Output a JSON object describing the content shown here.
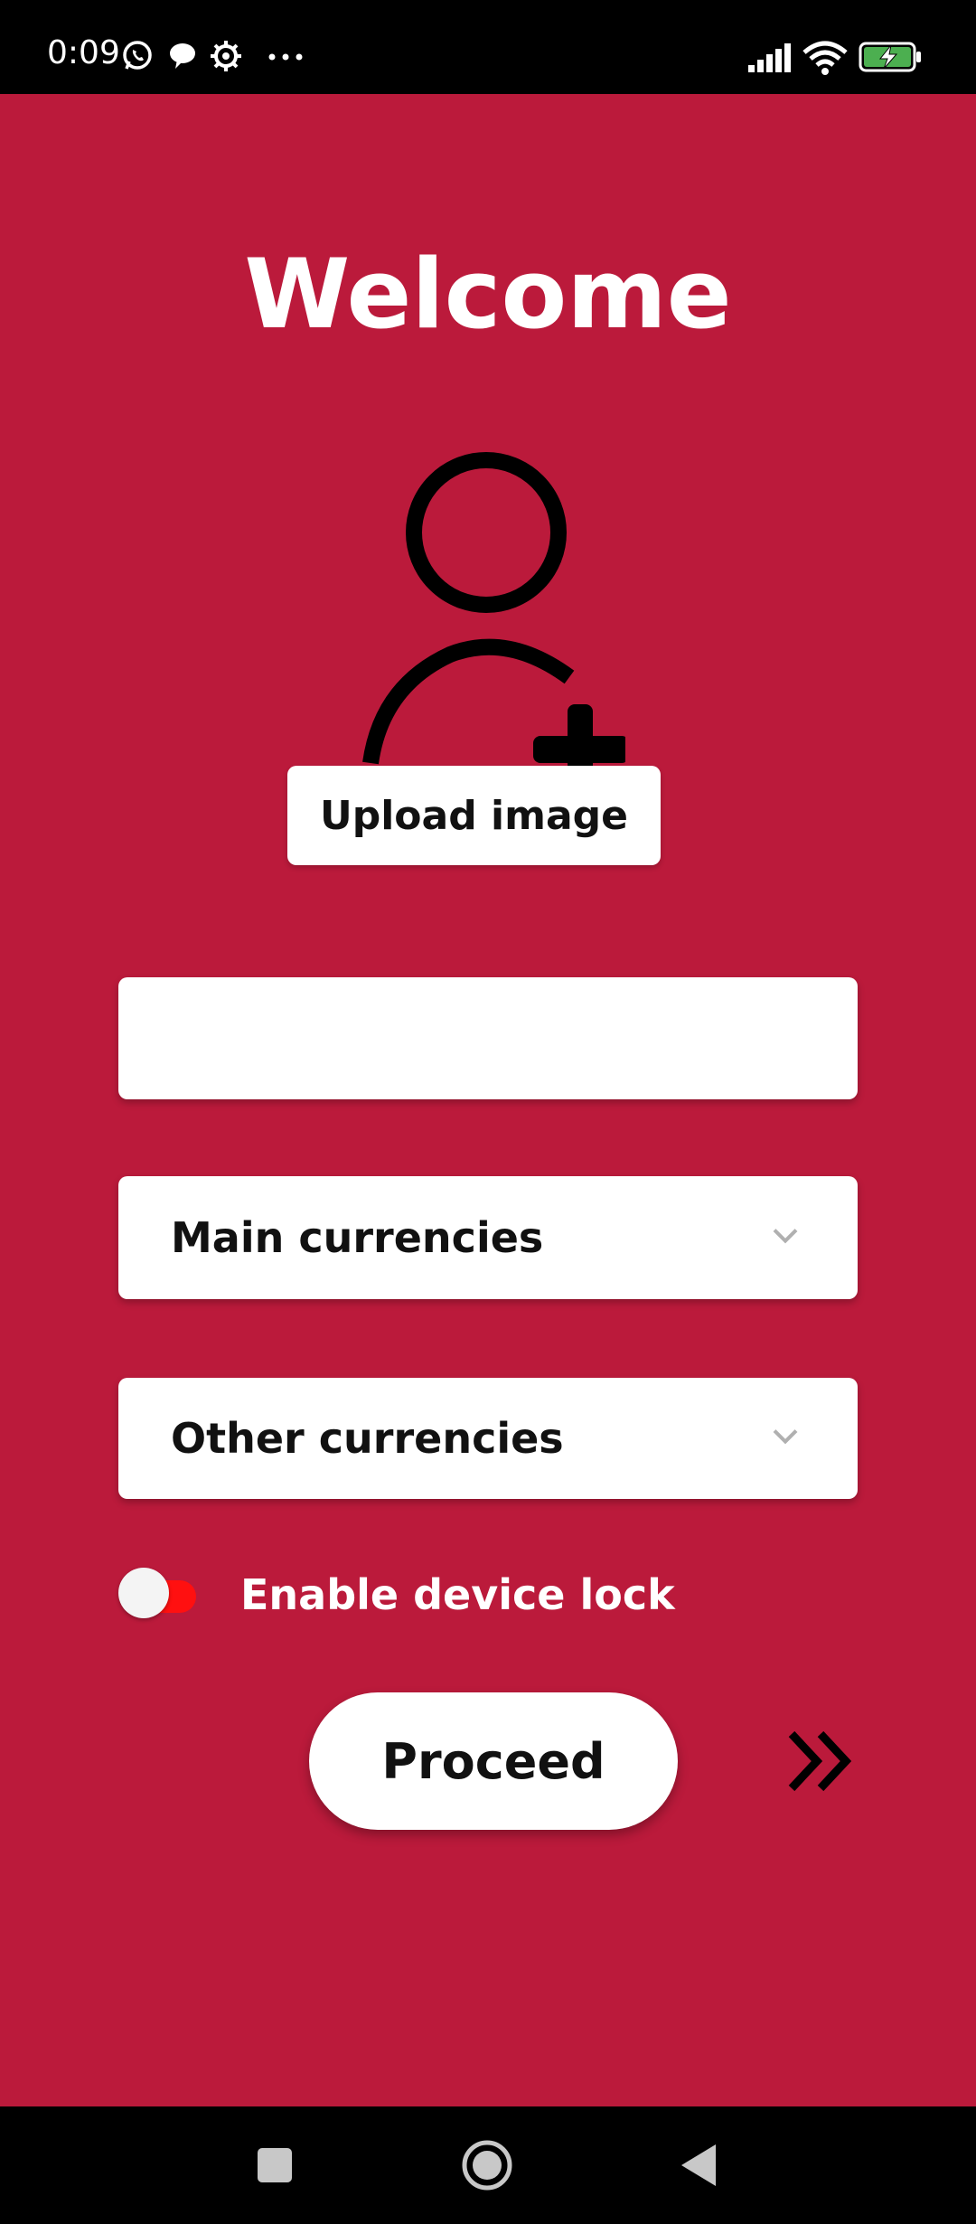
{
  "status_bar": {
    "time": "0:09",
    "icons": [
      "whatsapp-icon",
      "chat-bubble-icon",
      "settings-gear-icon",
      "more-dots-icon",
      "signal-icon",
      "wifi-icon",
      "battery-charging-icon"
    ]
  },
  "main": {
    "title": "Welcome",
    "upload_button_label": "Upload image",
    "name_input_value": "",
    "main_currencies_label": "Main currencies",
    "other_currencies_label": "Other currencies",
    "device_lock_label": "Enable device lock",
    "device_lock_enabled": false,
    "proceed_label": "Proceed"
  },
  "colors": {
    "background": "#bb1a3b",
    "toggle_track": "#ff1010",
    "battery": "#4caf50"
  },
  "nav_bar": {
    "buttons": [
      "recents-square-icon",
      "home-circle-icon",
      "back-triangle-icon"
    ]
  }
}
